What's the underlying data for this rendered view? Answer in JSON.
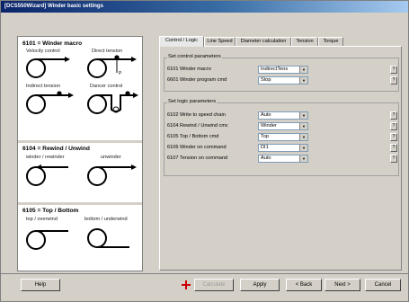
{
  "window": {
    "title": "[DCS550Wizard] Winder basic settings"
  },
  "left_panel": {
    "macro": {
      "title": "6101 = Winder macro",
      "labels": [
        "Velocity control",
        "Direct tension",
        "Indirect tension",
        "Dancer control"
      ],
      "feedback_letter": "P"
    },
    "rewind": {
      "title": "6104 = Rewind / Unwind",
      "labels": [
        "winder / rewinder",
        "unwinder"
      ]
    },
    "topbottom": {
      "title": "6105 = Top / Bottom",
      "labels": [
        "top / overwind",
        "bottom / underwind"
      ]
    }
  },
  "tabs": [
    "Control / Logic",
    "Line Speed",
    "Diameter calculation",
    "Tension",
    "Torque"
  ],
  "control_group": {
    "title": "Set control parameters",
    "rows": [
      {
        "label": "6101 Winder macro",
        "value": "IndirectTens"
      },
      {
        "label": "6601 Winder program cmd",
        "value": "Stop"
      }
    ]
  },
  "logic_group": {
    "title": "Set logic parameters",
    "rows": [
      {
        "label": "6102 Write to speed chain",
        "value": "Auto"
      },
      {
        "label": "6104 Rewind / Unwind cmc",
        "value": "Winder"
      },
      {
        "label": "6105 Top / Bottom cmd",
        "value": "Top"
      },
      {
        "label": "6106 Winder on command",
        "value": "DI1"
      },
      {
        "label": "6107 Tension on command",
        "value": "Auto"
      }
    ]
  },
  "help_glyph": "?",
  "footer": {
    "help": "Help",
    "calculate": "Calculate",
    "apply": "Apply",
    "back": "< Back",
    "next": "Next >",
    "cancel": "Cancel"
  },
  "colors": {
    "title_start": "#0a246a",
    "title_end": "#a6caf0",
    "calc_icon": "#cc0000"
  }
}
